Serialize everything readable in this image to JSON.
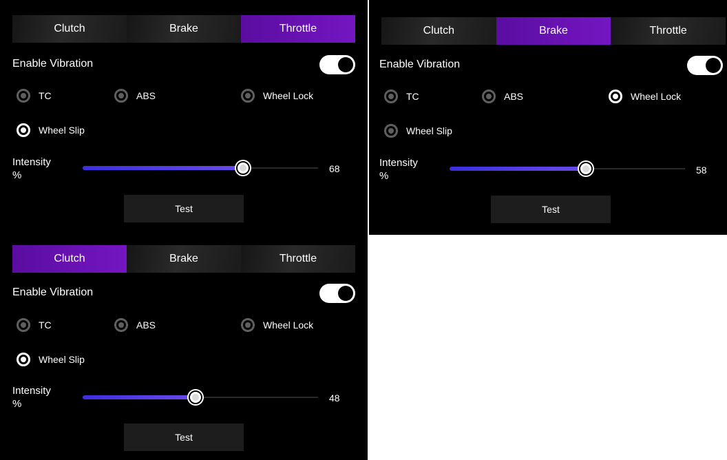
{
  "panels": [
    {
      "tabs": [
        {
          "label": "Clutch",
          "active": false
        },
        {
          "label": "Brake",
          "active": false
        },
        {
          "label": "Throttle",
          "active": true
        }
      ],
      "enable_label": "Enable Vibration",
      "enabled": true,
      "options": [
        {
          "label": "TC",
          "selected": false
        },
        {
          "label": "ABS",
          "selected": false
        },
        {
          "label": "Wheel Lock",
          "selected": false
        },
        {
          "label": "Wheel Slip",
          "selected": true
        }
      ],
      "intensity_label_1": "Intensity",
      "intensity_label_2": "%",
      "intensity_value": "68",
      "intensity": 68,
      "test_label": "Test"
    },
    {
      "tabs": [
        {
          "label": "Clutch",
          "active": false
        },
        {
          "label": "Brake",
          "active": true
        },
        {
          "label": "Throttle",
          "active": false
        }
      ],
      "enable_label": "Enable Vibration",
      "enabled": true,
      "options": [
        {
          "label": "TC",
          "selected": false
        },
        {
          "label": "ABS",
          "selected": false
        },
        {
          "label": "Wheel Lock",
          "selected": true
        },
        {
          "label": "Wheel Slip",
          "selected": false
        }
      ],
      "intensity_label_1": "Intensity",
      "intensity_label_2": "%",
      "intensity_value": "58",
      "intensity": 58,
      "test_label": "Test"
    },
    {
      "tabs": [
        {
          "label": "Clutch",
          "active": true
        },
        {
          "label": "Brake",
          "active": false
        },
        {
          "label": "Throttle",
          "active": false
        }
      ],
      "enable_label": "Enable Vibration",
      "enabled": true,
      "options": [
        {
          "label": "TC",
          "selected": false
        },
        {
          "label": "ABS",
          "selected": false
        },
        {
          "label": "Wheel Lock",
          "selected": false
        },
        {
          "label": "Wheel Slip",
          "selected": true
        }
      ],
      "intensity_label_1": "Intensity",
      "intensity_label_2": "%",
      "intensity_value": "48",
      "intensity": 48,
      "test_label": "Test"
    }
  ],
  "colors": {
    "active_tab": "#6a12b5",
    "slider_fill": "#4a3ce4",
    "panel_bg": "#000000"
  }
}
